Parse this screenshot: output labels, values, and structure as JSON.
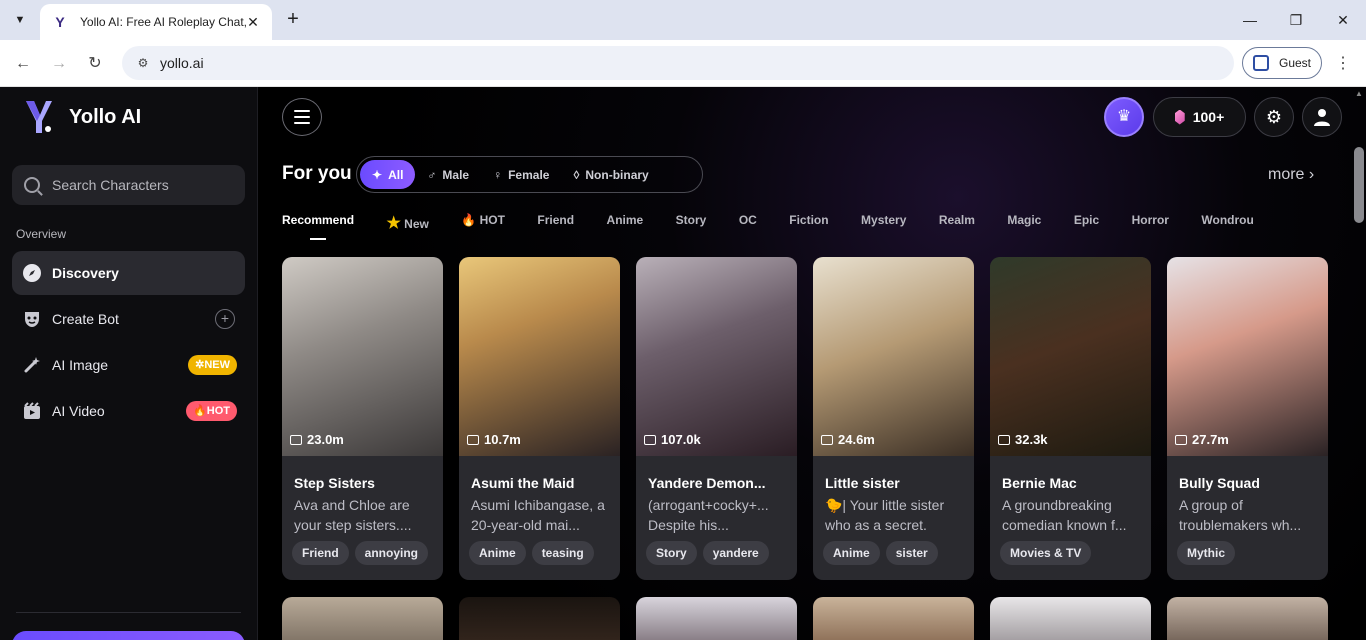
{
  "browser": {
    "tab_title": "Yollo AI: Free AI Roleplay Chat, AI",
    "url": "yollo.ai",
    "profile_label": "Guest"
  },
  "sidebar": {
    "brand": "Yollo AI",
    "search_placeholder": "Search Characters",
    "section_label": "Overview",
    "items": [
      {
        "label": "Discovery",
        "icon": "compass-icon",
        "active": true
      },
      {
        "label": "Create Bot",
        "icon": "mask-icon"
      },
      {
        "label": "AI Image",
        "icon": "magic-wand-icon",
        "badge": "NEW"
      },
      {
        "label": "AI Video",
        "icon": "video-icon",
        "badge": "HOT"
      }
    ]
  },
  "header": {
    "gem_count": "100+"
  },
  "main": {
    "heading": "For you",
    "filters": [
      "All",
      "Male",
      "Female",
      "Non-binary"
    ],
    "more_label": "more",
    "categories": [
      "Recommend",
      "New",
      "HOT",
      "Friend",
      "Anime",
      "Story",
      "OC",
      "Fiction",
      "Mystery",
      "Realm",
      "Magic",
      "Epic",
      "Horror",
      "Wondrou"
    ],
    "cards": [
      {
        "stat": "23.0m",
        "name": "Step Sisters",
        "desc": "Ava and Chloe are your step sisters....",
        "tags": [
          "Friend",
          "annoying"
        ]
      },
      {
        "stat": "10.7m",
        "name": "Asumi the Maid",
        "desc": "Asumi Ichibangase, a 20-year-old mai...",
        "tags": [
          "Anime",
          "teasing"
        ]
      },
      {
        "stat": "107.0k",
        "name": "Yandere Demon...",
        "desc": "(arrogant+cocky+... Despite his...",
        "tags": [
          "Story",
          "yandere"
        ]
      },
      {
        "stat": "24.6m",
        "name": "Little sister",
        "desc": "🐤| Your little sister who as a secret.",
        "tags": [
          "Anime",
          "sister"
        ]
      },
      {
        "stat": "32.3k",
        "name": "Bernie Mac",
        "desc": "A groundbreaking comedian known f...",
        "tags": [
          "Movies & TV"
        ]
      },
      {
        "stat": "27.7m",
        "name": "Bully Squad",
        "desc": "A group of troublemakers wh...",
        "tags": [
          "Mythic"
        ]
      }
    ]
  },
  "colors": {
    "accent": "#7b55ff",
    "badge_new": "#f0b400",
    "badge_hot": "#ff5a6e"
  }
}
